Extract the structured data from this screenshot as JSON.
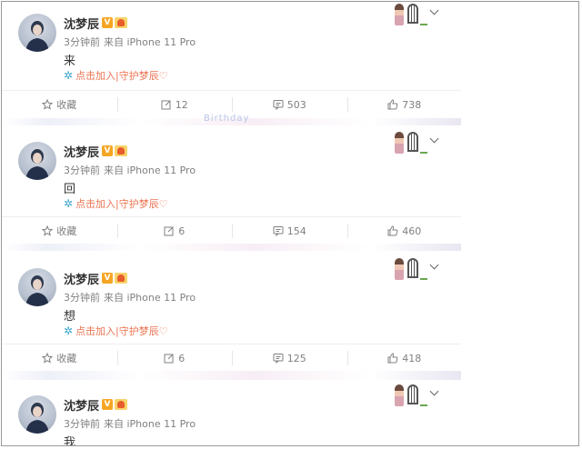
{
  "posts": [
    {
      "username": "沈梦辰",
      "vip_badge": "V",
      "time": "3分钟前",
      "source": "来自 iPhone 11 Pro",
      "content": "来",
      "tag": "点击加入|守护梦辰♡",
      "actions": {
        "favorite": "收藏",
        "repost": "12",
        "comment": "503",
        "like": "738"
      }
    },
    {
      "username": "沈梦辰",
      "vip_badge": "V",
      "time": "3分钟前",
      "source": "来自 iPhone 11 Pro",
      "content": "回",
      "tag": "点击加入|守护梦辰♡",
      "actions": {
        "favorite": "收藏",
        "repost": "6",
        "comment": "154",
        "like": "460"
      }
    },
    {
      "username": "沈梦辰",
      "vip_badge": "V",
      "time": "3分钟前",
      "source": "来自 iPhone 11 Pro",
      "content": "想",
      "tag": "点击加入|守护梦辰♡",
      "actions": {
        "favorite": "收藏",
        "repost": "6",
        "comment": "125",
        "like": "418"
      }
    },
    {
      "username": "沈梦辰",
      "vip_badge": "V",
      "time": "3分钟前",
      "source": "来自 iPhone 11 Pro",
      "content": "我"
    }
  ],
  "band_text": "Birthday",
  "icons": {
    "favorite": "star-icon",
    "repost": "repost-icon",
    "comment": "comment-icon",
    "like": "thumbs-up-icon",
    "tag": "asterisk-icon",
    "menu": "chevron-down-icon"
  },
  "colors": {
    "tag": "#eb7350",
    "muted": "#808080",
    "text": "#333333"
  }
}
